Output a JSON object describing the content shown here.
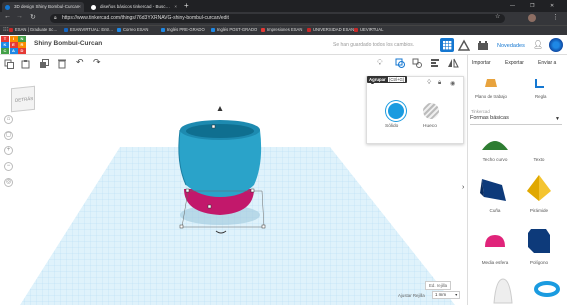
{
  "browser": {
    "tabs": [
      {
        "title": "3D design Shiny Bombul-Curcan",
        "active": true
      },
      {
        "title": "diseños básicos tinkercad - Busc…",
        "active": false
      }
    ],
    "new_tab": "+",
    "window_controls": [
      "—",
      "❐",
      "✕"
    ],
    "url": "https://www.tinkercad.com/things/76d3YXRNAVG-shiny-bombul-curcan/edit",
    "bookmarks": [
      {
        "label": "ESAN | Graduate Sc…",
        "color": "#c62828"
      },
      {
        "label": "ESANVIRTUAL: Entr…",
        "color": "#1565c0"
      },
      {
        "label": "Correo ESAN",
        "color": "#1e88e5"
      },
      {
        "label": "Inglés PRE-GRADO",
        "color": "#1e88e5"
      },
      {
        "label": "Inglés POST-GRADO",
        "color": "#1e88e5"
      },
      {
        "label": "Impresiones ESAN",
        "color": "#e53935"
      },
      {
        "label": "UNIVERSIDAD ESAN",
        "color": "#c62828"
      },
      {
        "label": "UEVIRTUAL",
        "color": "#c62828"
      }
    ]
  },
  "app": {
    "logo_letters": [
      "T",
      "I",
      "N",
      "K",
      "E",
      "R",
      "C",
      "A",
      "D"
    ],
    "design_name": "Shiny Bombul-Curcan",
    "save_status": "Se han guardado todos los cambios.",
    "novedades": "Novedades",
    "toolbar_actions": {
      "import": "Importar",
      "export": "Exportar",
      "send": "Enviar a"
    },
    "tooltip": {
      "group": "Agrupar",
      "shortcut": "(Ctrl+G)"
    }
  },
  "viewcube": {
    "face": "DETRÁS"
  },
  "inspector": {
    "solid_label": "Sólido",
    "hole_label": "Hueco",
    "solid_color": "#1a9be0"
  },
  "right_panel": {
    "workplane": "Plano de trabajo",
    "ruler": "Regla",
    "library_header": "Tinkercad",
    "library_select": "Formas básicas",
    "shapes": [
      "Techo curvo",
      "Texto",
      "Cuña",
      "Pirámide",
      "Media esfera",
      "Polígono"
    ]
  },
  "bottom": {
    "edit_grid": "Ed. rejilla",
    "snap_label": "Ajustar Rejilla",
    "snap_value": "1 mm"
  },
  "colors": {
    "accent": "#1477d1",
    "pot": "#2aa3c9",
    "base": "#c2186b"
  }
}
